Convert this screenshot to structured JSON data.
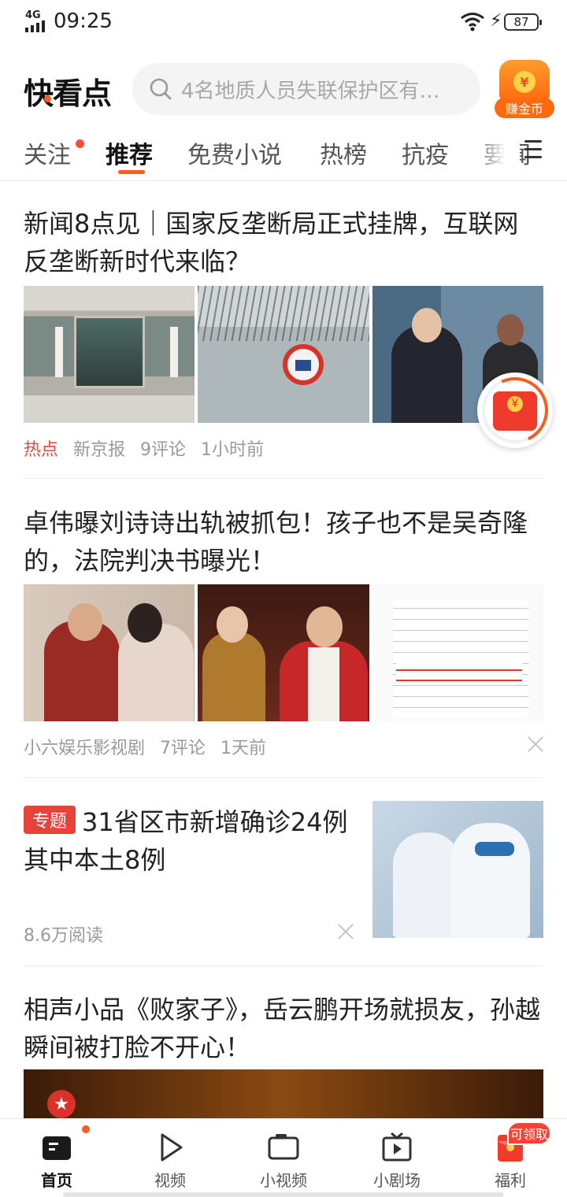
{
  "status_bar": {
    "network": "4G",
    "time": "09:25",
    "battery": "87"
  },
  "header": {
    "logo": "快看点",
    "search_placeholder": "4名地质人员失联保护区有…",
    "coin_label": "赚金币",
    "coin_symbol": "¥"
  },
  "tabs": [
    {
      "label": "关注"
    },
    {
      "label": "推荐"
    },
    {
      "label": "免费小说"
    },
    {
      "label": "热榜"
    },
    {
      "label": "抗疫"
    },
    {
      "label": "要闻"
    }
  ],
  "feed": [
    {
      "title": "新闻8点见｜国家反垄断局正式挂牌，互联网反垄断新时代来临？",
      "tag": "热点",
      "source": "新京报",
      "comments": "9评论",
      "time": "1小时前"
    },
    {
      "title": "卓伟曝刘诗诗出轨被抓包！孩子也不是吴奇隆的，法院判决书曝光！",
      "source": "小六娱乐影视剧",
      "comments": "7评论",
      "time": "1天前"
    },
    {
      "topic_tag": "专题",
      "title": "31省区市新增确诊24例 其中本土8例",
      "reads": "8.6万阅读"
    },
    {
      "title": "相声小品《败家子》，岳云鹏开场就损友，孙越瞬间被打脸不开心！"
    }
  ],
  "bottom_nav": [
    {
      "label": "首页"
    },
    {
      "label": "视频"
    },
    {
      "label": "小视频"
    },
    {
      "label": "小剧场"
    },
    {
      "label": "福利"
    }
  ],
  "claim_badge": "可领取",
  "colors": {
    "accent": "#ff5a1f",
    "hot": "#e84a3c",
    "topic": "#e8433a"
  }
}
